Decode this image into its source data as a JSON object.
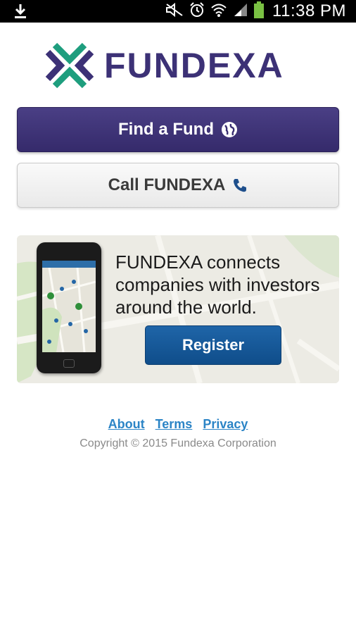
{
  "status_bar": {
    "time": "11:38 PM"
  },
  "brand": {
    "name": "FUNDEXA"
  },
  "buttons": {
    "find_fund": "Find a Fund",
    "call": "Call FUNDEXA"
  },
  "promo": {
    "text": "FUNDEXA connects companies with investors around the world.",
    "register": "Register"
  },
  "footer": {
    "links": [
      "About",
      "Terms",
      "Privacy"
    ],
    "copyright": "Copyright © 2015 Fundexa Corporation"
  },
  "colors": {
    "primary": "#3c3176",
    "accent_green": "#1e9e7e",
    "register_blue": "#13568f",
    "link_blue": "#2b84c6"
  }
}
